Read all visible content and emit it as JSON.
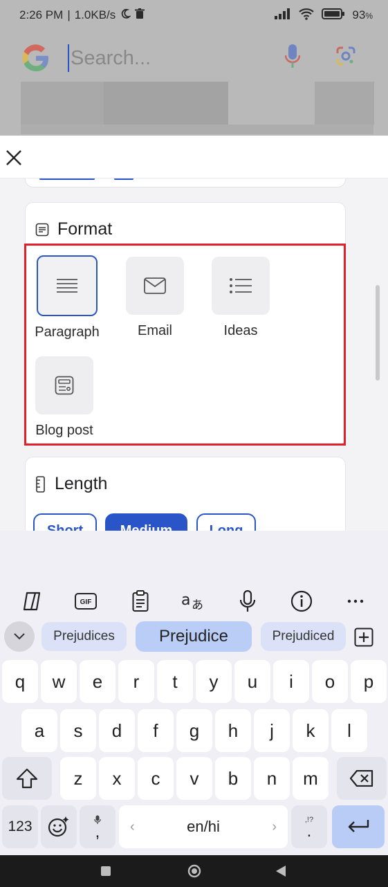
{
  "status_bar": {
    "time": "2:26 PM",
    "speed": "1.0KB/s",
    "battery": "93"
  },
  "google": {
    "search_placeholder": "Search..."
  },
  "format": {
    "title": "Format",
    "options": [
      {
        "label": "Paragraph",
        "icon": "paragraph-icon",
        "selected": true
      },
      {
        "label": "Email",
        "icon": "email-icon",
        "selected": false
      },
      {
        "label": "Ideas",
        "icon": "list-icon",
        "selected": false
      },
      {
        "label": "Blog post",
        "icon": "blog-post-icon",
        "selected": false
      }
    ]
  },
  "length": {
    "title": "Length",
    "options": [
      {
        "label": "Short",
        "selected": false
      },
      {
        "label": "Medium",
        "selected": true
      },
      {
        "label": "Long",
        "selected": false
      }
    ]
  },
  "keyboard": {
    "suggestions": [
      "Prejudices",
      "Prejudice",
      "Prejudiced"
    ],
    "row1": [
      "q",
      "w",
      "e",
      "r",
      "t",
      "y",
      "u",
      "i",
      "o",
      "p"
    ],
    "row2": [
      "a",
      "s",
      "d",
      "f",
      "g",
      "h",
      "j",
      "k",
      "l"
    ],
    "row3": [
      "z",
      "x",
      "c",
      "v",
      "b",
      "n",
      "m"
    ],
    "numbers_key": "123",
    "space_label": "en/hi",
    "comma_key": ",",
    "period_key": ".",
    "period_alt": ",!?"
  },
  "colors": {
    "accent": "#2a55c8",
    "highlight": "#e0202a"
  }
}
